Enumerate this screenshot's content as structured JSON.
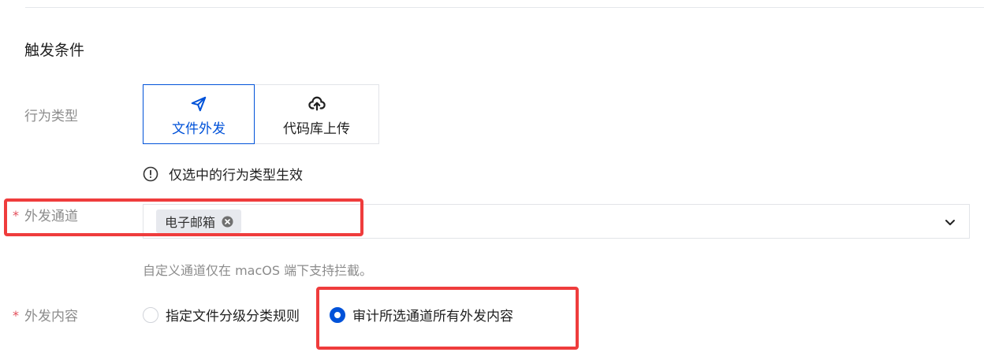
{
  "section": {
    "title": "触发条件"
  },
  "behavior_type": {
    "label": "行为类型",
    "options": [
      {
        "label": "文件外发",
        "icon": "send-icon",
        "selected": true
      },
      {
        "label": "代码库上传",
        "icon": "cloud-upload-icon",
        "selected": false
      }
    ],
    "hint": "仅选中的行为类型生效"
  },
  "channel": {
    "required_mark": "*",
    "label": "外发通道",
    "selected_tags": [
      "电子邮箱"
    ],
    "help_text": "自定义通道仅在 macOS 端下支持拦截。"
  },
  "content": {
    "required_mark": "*",
    "label": "外发内容",
    "options": [
      {
        "label": "指定文件分级分类规则",
        "checked": false
      },
      {
        "label": "审计所选通道所有外发内容",
        "checked": true
      }
    ]
  },
  "colors": {
    "accent": "#0052d9",
    "required": "#e34d59",
    "annotation": "#ef3c3c"
  }
}
